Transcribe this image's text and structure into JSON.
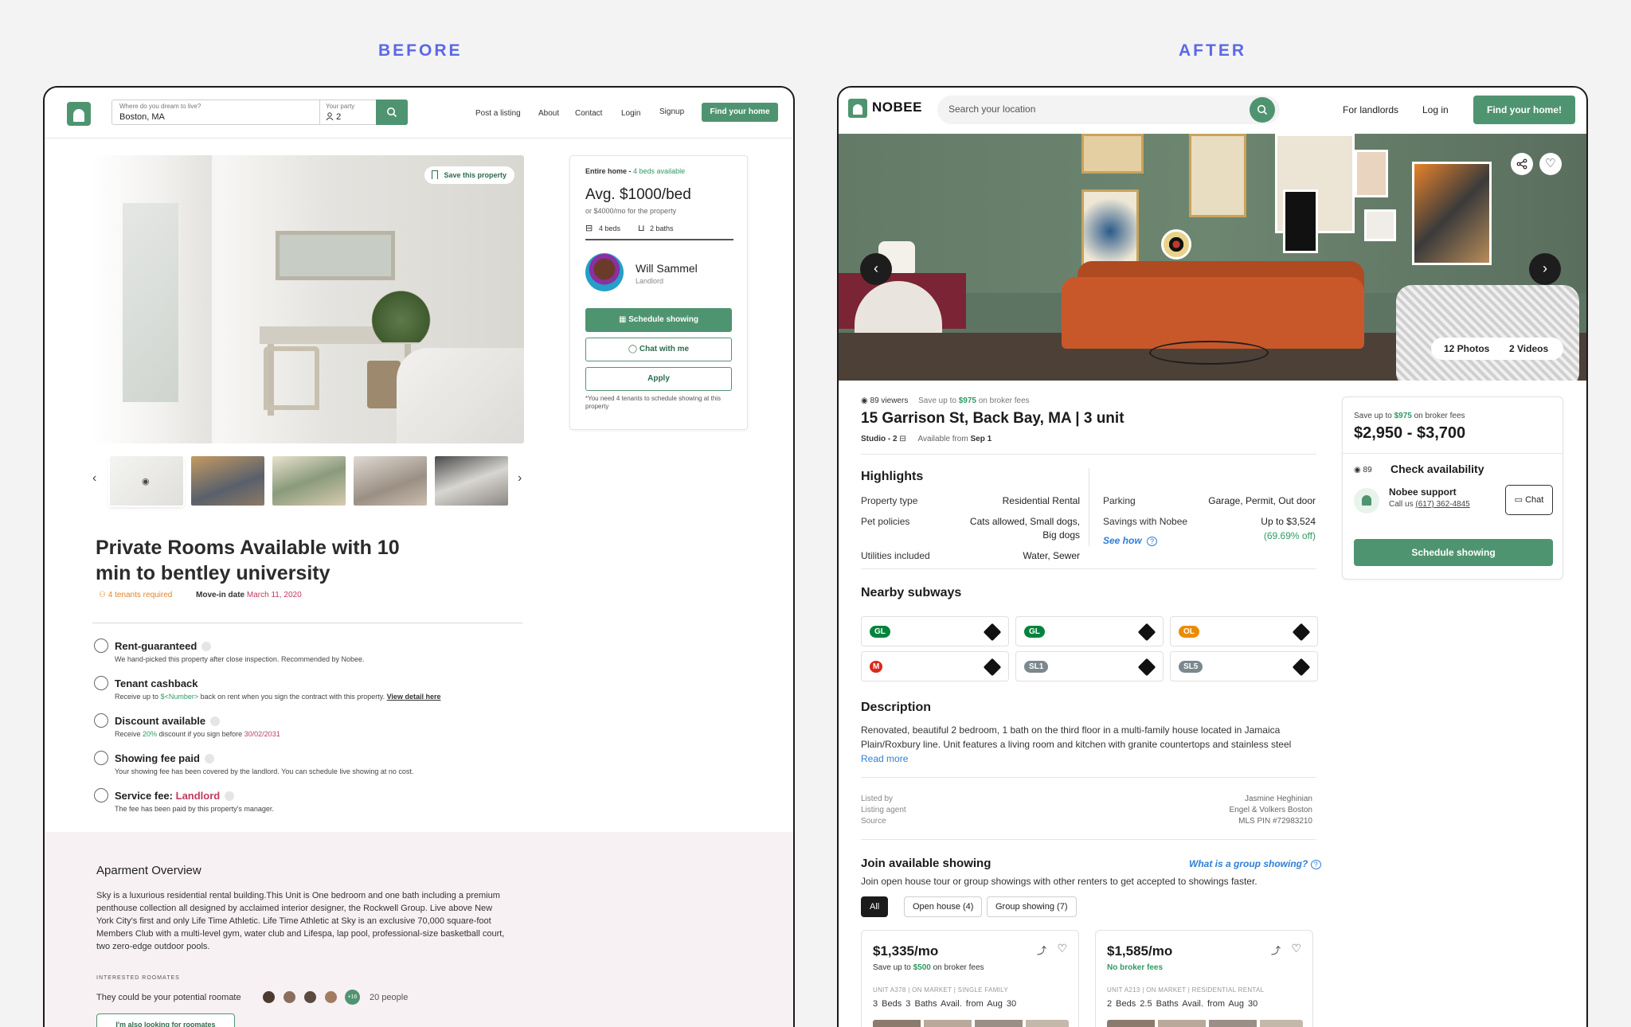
{
  "labels": {
    "before": "BEFORE",
    "after": "AFTER"
  },
  "before": {
    "search": {
      "where_label": "Where do you dream to live?",
      "where_value": "Boston, MA",
      "party_label": "Your party",
      "party_value": "2"
    },
    "nav": [
      "Post a listing",
      "About",
      "Contact",
      "Login",
      "Signup"
    ],
    "cta": "Find your home",
    "save": "Save this property",
    "title": "Private Rooms Available with 10 min to bentley university",
    "tenants": "4 tenants required",
    "movein_label": "Move-in date",
    "movein_date": "March 11, 2020",
    "features": [
      {
        "title": "Rent-guaranteed",
        "sub": "We hand-picked this property after close inspection. Recommended by Nobee."
      },
      {
        "title": "Tenant cashback",
        "sub_a": "Receive up to",
        "sub_b": "$<Number>",
        "sub_c": "back on rent when you sign the contract with this property.",
        "link": "View detail here"
      },
      {
        "title": "Discount available",
        "sub_a": "Receive",
        "sub_b": "20%",
        "sub_c": "discount if you sign before",
        "sub_d": "30/02/2031"
      },
      {
        "title": "Showing fee paid",
        "sub": "Your showing fee has been covered by the landlord. You can schedule live showing at no cost."
      },
      {
        "title_a": "Service fee:",
        "title_b": "Landlord",
        "sub": "The fee has been paid by this property's manager."
      }
    ],
    "card": {
      "type": "Entire home -",
      "beds_avail": "4 beds available",
      "price": "Avg. $1000/bed",
      "sub": "or $4000/mo for the property",
      "beds": "4 beds",
      "baths": "2 baths",
      "name": "Will Sammel",
      "role": "Landlord",
      "schedule": "Schedule showing",
      "chat": "Chat with me",
      "apply": "Apply",
      "note": "*You need 4 tenants to schedule showing at this property"
    },
    "overview": {
      "title": "Aparment Overview",
      "body": "Sky is a luxurious residential rental building.This Unit is One bedroom and one bath including a premium penthouse collection all designed by acclaimed interior designer, the Rockwell Group. Live above New York City's first and only Life Time Athletic. Life Time Athletic at Sky is an exclusive 70,000 square-foot Members Club with a multi-level gym, water club and Lifespa, lap pool, professional-size basketball court, two zero-edge outdoor pools.",
      "caption": "INTERESTED ROOMATES",
      "prompt": "They could be your potential roomate",
      "more": "+16",
      "count": "20 people",
      "button": "I'm also looking for roomates"
    }
  },
  "after": {
    "brand": "NOBEE",
    "search_placeholder": "Search your location",
    "landlords": "For landlords",
    "login": "Log in",
    "cta": "Find your home!",
    "photos": "12 Photos",
    "videos": "2 Videos",
    "viewers": "89 viewers",
    "save_a": "Save up to",
    "save_b": "$975",
    "save_c": "on broker fees",
    "address": "15 Garrison St, Back Bay, MA | 3 unit",
    "studio": "Studio - 2",
    "available_label": "Available from",
    "available_date": "Sep 1",
    "highlights_title": "Highlights",
    "highlights": {
      "property_type_label": "Property type",
      "property_type": "Residential Rental",
      "pets_label": "Pet policies",
      "pets_1": "Cats allowed, Small dogs,",
      "pets_2": "Big dogs",
      "utilities_label": "Utilities included",
      "utilities": "Water, Sewer",
      "parking_label": "Parking",
      "parking": "Garage, Permit, Out door",
      "savings_label": "Savings with Nobee",
      "savings": "Up to $3,524",
      "savings_pct": "(69.69% off)",
      "see_how": "See how"
    },
    "subways_title": "Nearby subways",
    "subways": [
      "GL",
      "GL",
      "OL",
      "M",
      "SL1",
      "SL5"
    ],
    "description_title": "Description",
    "description": "Renovated, beautiful 2 bedroom, 1 bath on the third floor in a multi-family house located in Jamaica Plain/Roxbury line. Unit features a living room and kitchen with granite countertops and stainless steel",
    "read_more": "Read more",
    "listed": {
      "l1": "Listed by",
      "l2": "Listing agent",
      "l3": "Source",
      "v1": "Jasmine Heghinian",
      "v2": "Engel & Volkers Boston",
      "v3": "MLS PIN #72983210"
    },
    "join_title": "Join available showing",
    "group_link": "What is a group showing?",
    "join_sub": "Join open house tour or group showings with other renters to get accepted to showings faster.",
    "chips": [
      "All",
      "Open house (4)",
      "Group showing (7)"
    ],
    "listings": [
      {
        "price": "$1,335/mo",
        "fee_a": "Save up to",
        "fee_b": "$500",
        "fee_c": "on broker fees",
        "unit": "UNIT A378  |  ON MARKET  |  SINGLE FAMILY",
        "details": "3 Beds   3 Baths   Avail. from Aug 30"
      },
      {
        "price": "$1,585/mo",
        "fee": "No broker fees",
        "unit": "UNIT A213  |  ON MARKET  |  RESIDENTIAL RENTAL",
        "details": "2 Beds   2.5 Baths   Avail. from Aug 30"
      }
    ],
    "side": {
      "save_a": "Save up to",
      "save_b": "$975",
      "save_c": "on broker fees",
      "price": "$2,950 - $3,700",
      "views": "89",
      "check": "Check availability",
      "support": "Nobee support",
      "phone_a": "Call us",
      "phone_b": "(617) 362-4845",
      "chat": "Chat",
      "schedule": "Schedule showing"
    }
  }
}
